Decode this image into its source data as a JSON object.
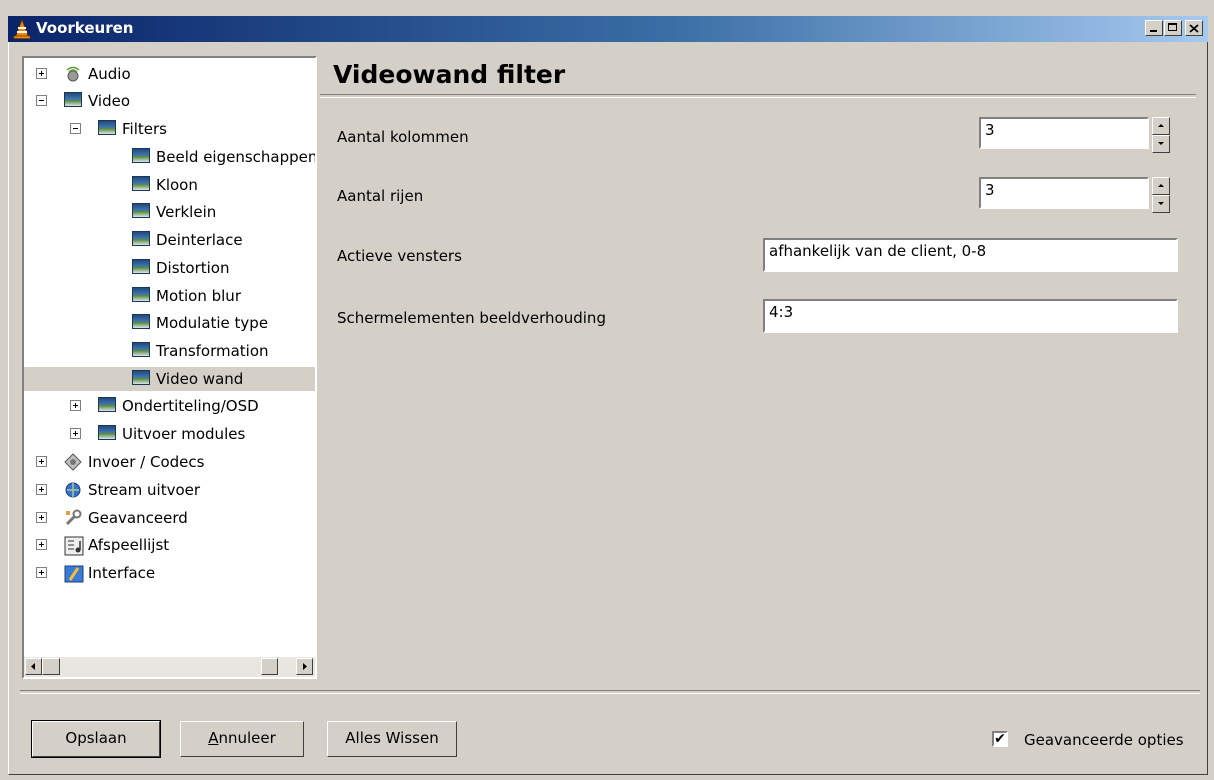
{
  "window": {
    "title": "Voorkeuren"
  },
  "tree": {
    "nodes": [
      {
        "label": "Audio",
        "icon": "audio-icon"
      },
      {
        "label": "Video",
        "icon": "video-icon"
      },
      {
        "label": "Filters",
        "icon": "video-icon"
      },
      {
        "label": "Beeld eigenschappen",
        "icon": "video-icon"
      },
      {
        "label": "Kloon",
        "icon": "video-icon"
      },
      {
        "label": "Verklein",
        "icon": "video-icon"
      },
      {
        "label": "Deinterlace",
        "icon": "video-icon"
      },
      {
        "label": "Distortion",
        "icon": "video-icon"
      },
      {
        "label": "Motion blur",
        "icon": "video-icon"
      },
      {
        "label": "Modulatie type",
        "icon": "video-icon"
      },
      {
        "label": "Transformation",
        "icon": "video-icon"
      },
      {
        "label": "Video wand",
        "icon": "video-icon"
      },
      {
        "label": "Ondertiteling/OSD",
        "icon": "video-icon"
      },
      {
        "label": "Uitvoer modules",
        "icon": "video-icon"
      },
      {
        "label": "Invoer / Codecs",
        "icon": "codecs-icon"
      },
      {
        "label": "Stream uitvoer",
        "icon": "stream-icon"
      },
      {
        "label": "Geavanceerd",
        "icon": "wrench-icon"
      },
      {
        "label": "Afspeellijst",
        "icon": "playlist-icon"
      },
      {
        "label": "Interface",
        "icon": "interface-icon"
      }
    ]
  },
  "panel": {
    "title": "Videowand filter",
    "fields": {
      "columns": {
        "label": "Aantal kolommen",
        "value": "3"
      },
      "rows": {
        "label": "Aantal rijen",
        "value": "3"
      },
      "active": {
        "label": "Actieve vensters",
        "value": "afhankelijk van de client, 0-8"
      },
      "aspect": {
        "label": "Schermelementen beeldverhouding",
        "value": "4:3"
      }
    }
  },
  "buttons": {
    "save": "Opslaan",
    "cancel": "Annuleer",
    "reset": "Alles Wissen"
  },
  "advanced": {
    "label": "Geavanceerde opties",
    "checked": true
  }
}
